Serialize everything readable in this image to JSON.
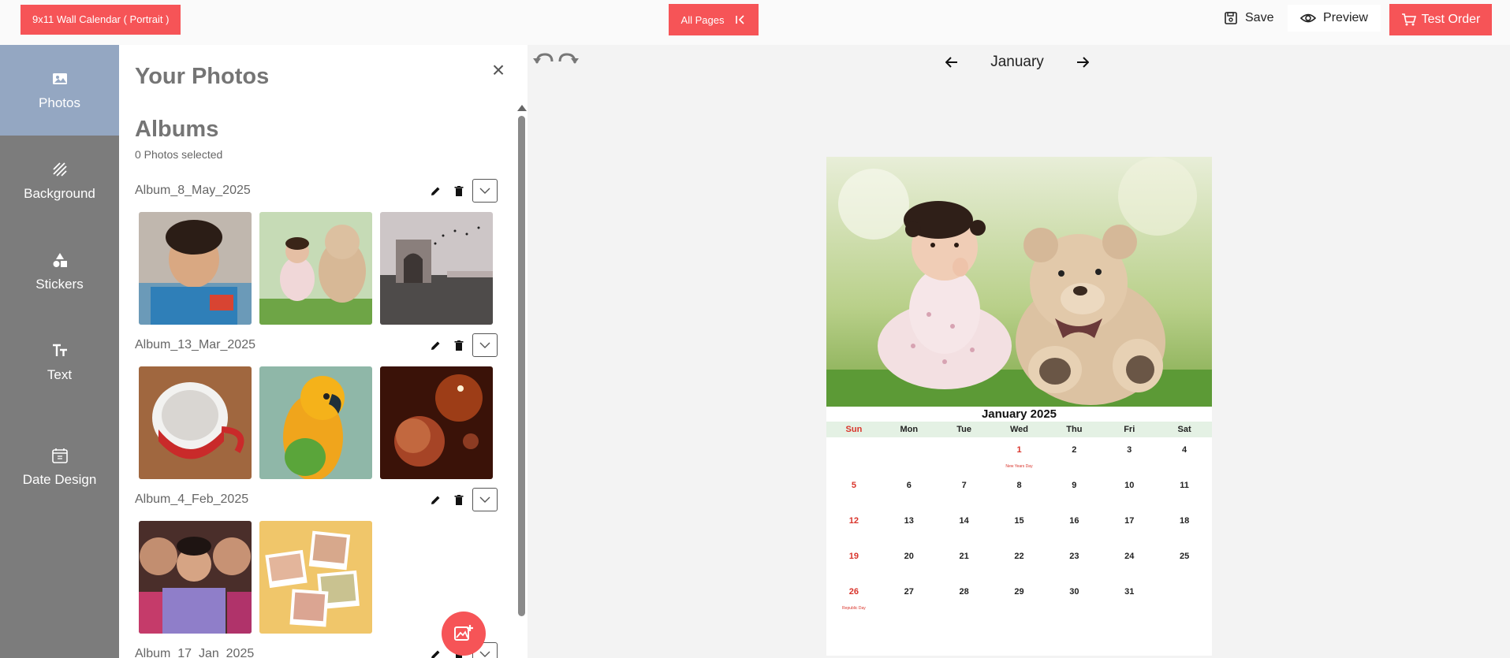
{
  "topbar": {
    "product": "9x11 Wall Calendar ( Portrait )",
    "all_pages": "All Pages",
    "save": "Save",
    "preview": "Preview",
    "test_order": "Test Order"
  },
  "nav": {
    "items": [
      {
        "label": "Photos",
        "icon": "image-icon",
        "active": true
      },
      {
        "label": "Background",
        "icon": "background-icon"
      },
      {
        "label": "Stickers",
        "icon": "shapes-icon"
      },
      {
        "label": "Text",
        "icon": "text-icon"
      },
      {
        "label": "Date Design",
        "icon": "calendar-icon"
      }
    ]
  },
  "panel": {
    "title": "Your Photos",
    "close": "×",
    "albums_title": "Albums",
    "selected": "0 Photos selected",
    "albums": [
      {
        "name": "Album_8_May_2025",
        "photos": [
          "child-on-blanket",
          "baby-with-teddy-bear",
          "gateway-monument-with-birds"
        ]
      },
      {
        "name": "Album_13_Mar_2025",
        "photos": [
          "white-cup",
          "parrot",
          "space-planets"
        ]
      },
      {
        "name": "Album_4_Feb_2025",
        "photos": [
          "family-selfie",
          "photo-collage"
        ]
      },
      {
        "name": "Album_17_Jan_2025",
        "photos": []
      }
    ]
  },
  "canvas": {
    "month": "January",
    "calendar": {
      "title": "January 2025",
      "weekdays": [
        "Sun",
        "Mon",
        "Tue",
        "Wed",
        "Thu",
        "Fri",
        "Sat"
      ],
      "weeks": [
        [
          "",
          "",
          "",
          "1",
          "2",
          "3",
          "4"
        ],
        [
          "5",
          "6",
          "7",
          "8",
          "9",
          "10",
          "11"
        ],
        [
          "12",
          "13",
          "14",
          "15",
          "16",
          "17",
          "18"
        ],
        [
          "19",
          "20",
          "21",
          "22",
          "23",
          "24",
          "25"
        ],
        [
          "26",
          "27",
          "28",
          "29",
          "30",
          "31",
          ""
        ]
      ],
      "holidays": {
        "1": "New Years Day",
        "26": "Republic Day"
      }
    }
  },
  "colors": {
    "accent": "#f65457",
    "nav_bg": "#7c7c7c",
    "nav_active": "#94a7c2",
    "sunday": "#d9342b"
  }
}
